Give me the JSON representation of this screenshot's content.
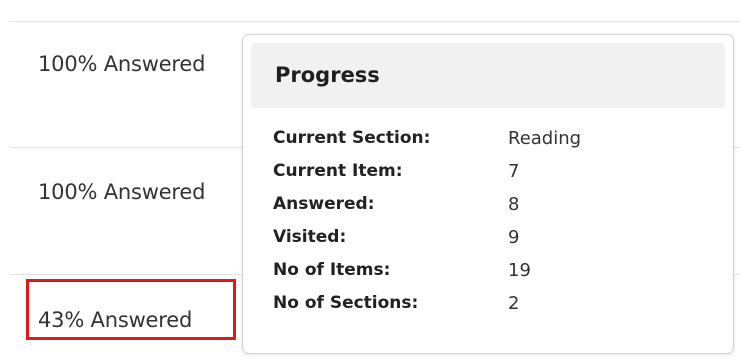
{
  "rows": [
    {
      "status": "100% Answered"
    },
    {
      "status": "100% Answered"
    },
    {
      "status": "43% Answered"
    }
  ],
  "popover": {
    "title": "Progress",
    "items": [
      {
        "label": "Current Section:",
        "value": "Reading"
      },
      {
        "label": "Current Item:",
        "value": "7"
      },
      {
        "label": "Answered:",
        "value": "8"
      },
      {
        "label": "Visited:",
        "value": "9"
      },
      {
        "label": "No of Items:",
        "value": "19"
      },
      {
        "label": "No of Sections:",
        "value": "2"
      }
    ]
  },
  "colors": {
    "highlight": "#e0191f"
  }
}
